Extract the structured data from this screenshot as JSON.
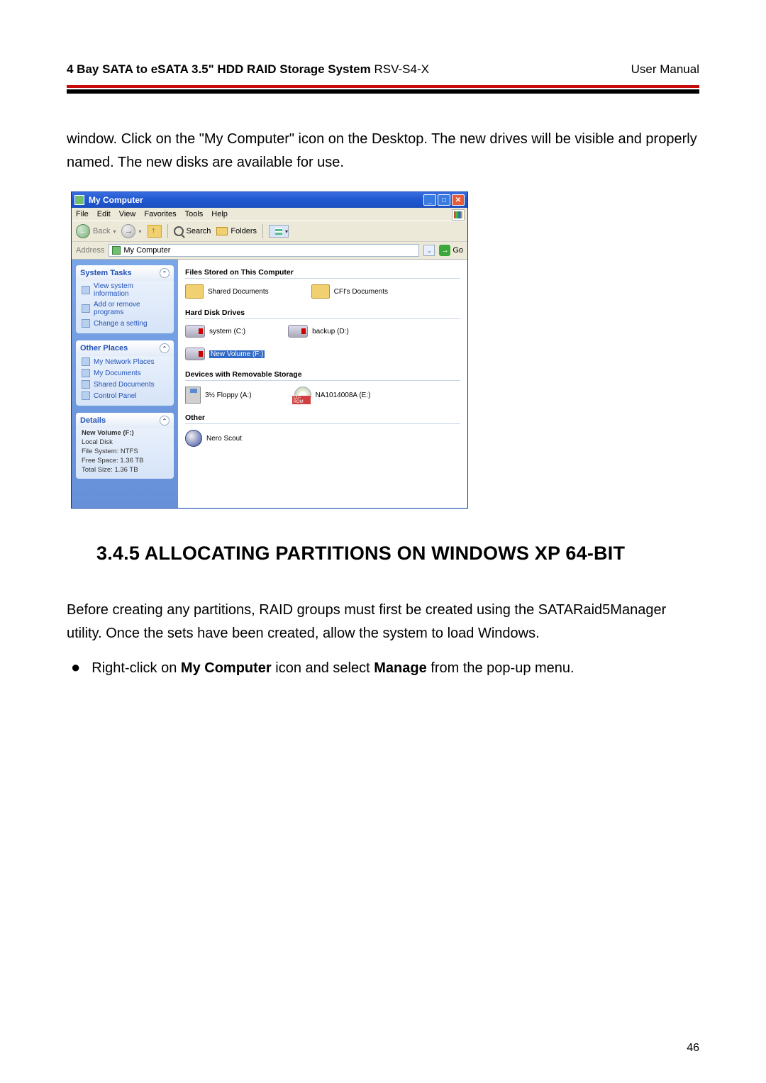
{
  "header": {
    "title_bold": "4 Bay SATA to eSATA 3.5\" HDD RAID Storage System",
    "title_model": " RSV-S4-X",
    "right": "User Manual"
  },
  "intro": "window. Click on the \"My Computer\" icon on the Desktop. The new drives will be visible and properly named. The new disks are available for use.",
  "window": {
    "title": "My Computer",
    "menus": [
      "File",
      "Edit",
      "View",
      "Favorites",
      "Tools",
      "Help"
    ],
    "toolbar": {
      "back": "Back",
      "search": "Search",
      "folders": "Folders"
    },
    "address": {
      "label": "Address",
      "value": "My Computer",
      "go": "Go"
    },
    "sidebar": {
      "tasks": {
        "title": "System Tasks",
        "items": [
          "View system information",
          "Add or remove programs",
          "Change a setting"
        ]
      },
      "places": {
        "title": "Other Places",
        "items": [
          "My Network Places",
          "My Documents",
          "Shared Documents",
          "Control Panel"
        ]
      },
      "details": {
        "title": "Details",
        "lines": [
          "New Volume (F:)",
          "Local Disk",
          "File System: NTFS",
          "Free Space: 1.36 TB",
          "Total Size: 1.36 TB"
        ]
      }
    },
    "content": {
      "sections": [
        {
          "head": "Files Stored on This Computer",
          "items": [
            {
              "icon": "folder",
              "label": "Shared Documents"
            },
            {
              "icon": "folder",
              "label": "CFI's Documents"
            }
          ]
        },
        {
          "head": "Hard Disk Drives",
          "items": [
            {
              "icon": "hdd",
              "label": "system (C:)"
            },
            {
              "icon": "hdd",
              "label": "backup (D:)"
            },
            {
              "icon": "hdd",
              "label": "New Volume (F:)",
              "selected": true
            }
          ]
        },
        {
          "head": "Devices with Removable Storage",
          "items": [
            {
              "icon": "floppy",
              "label": "3½ Floppy (A:)"
            },
            {
              "icon": "cd",
              "label": "NA1014008A (E:)"
            }
          ]
        },
        {
          "head": "Other",
          "items": [
            {
              "icon": "nero",
              "label": "Nero Scout"
            }
          ]
        }
      ]
    }
  },
  "heading": "3.4.5   ALLOCATING PARTITIONS ON WINDOWS XP 64-BIT",
  "para2": "Before creating any partitions, RAID groups must first be created using the SATARaid5Manager utility. Once the sets have been created, allow the system to load Windows.",
  "bullet": {
    "pre": "Right-click on ",
    "b1": "My Computer",
    "mid": " icon and select ",
    "b2": "Manage",
    "post": " from the pop-up menu."
  },
  "page_num": "46"
}
